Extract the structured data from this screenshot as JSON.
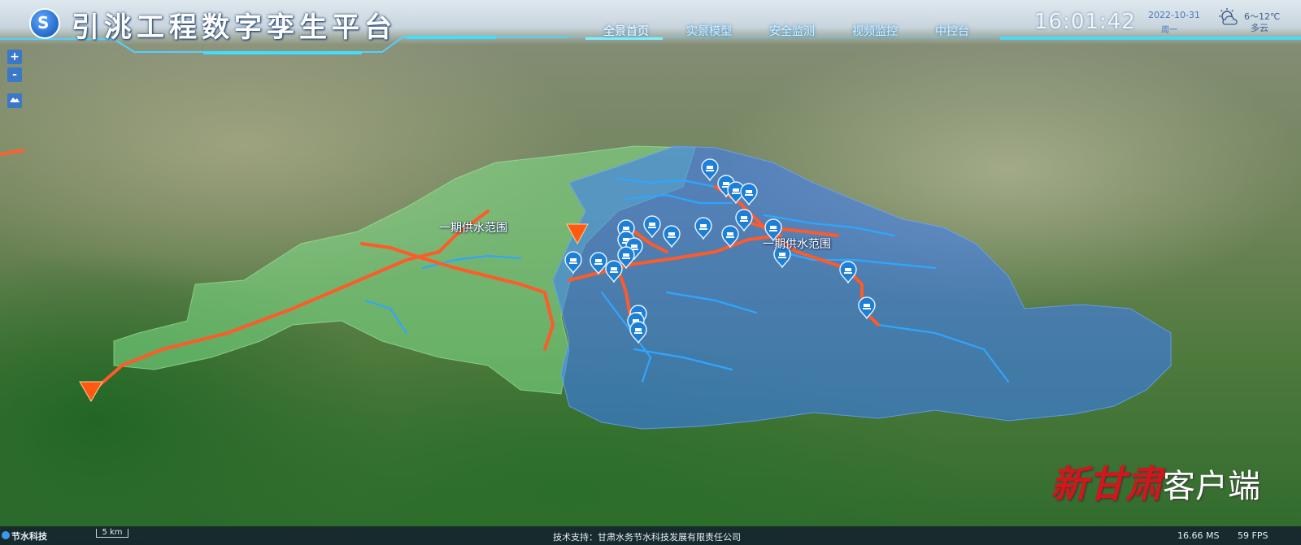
{
  "header": {
    "title": "引洮工程数字孪生平台",
    "logo_icon": "water-drop-logo-icon",
    "nav": [
      "全景首页",
      "实景模型",
      "安全监测",
      "视频监控",
      "中控台"
    ],
    "active_nav_index": 0,
    "time": "16:01:42",
    "date": "2022-10-31",
    "weekday": "周一",
    "weather": {
      "icon": "partly-cloudy-icon",
      "temp": "6～12℃",
      "desc": "多云"
    }
  },
  "map_controls": {
    "zoom_in": "+",
    "zoom_out": "-",
    "layers_icon": "layers-icon"
  },
  "map": {
    "labels": [
      "一期供水范围",
      "一期供水范围"
    ],
    "colors": {
      "green_zone": "#7fe08a",
      "blue_zone": "#3a7bff",
      "pipeline": "#ff5a2a",
      "river": "#2fa6ff",
      "marker": "#1e7fd6"
    },
    "marker_icon": "monitoring-station-pin-icon",
    "warning_icon": "orange-triangle-marker-icon"
  },
  "footer": {
    "brand": "节水科技",
    "scale": "5 km",
    "support": "技术支持：甘肃水务节水科技发展有限责任公司",
    "ms": "16.66 MS",
    "fps": "59 FPS"
  },
  "watermark": {
    "red_text": "新甘肃",
    "white_text": "客户端"
  }
}
